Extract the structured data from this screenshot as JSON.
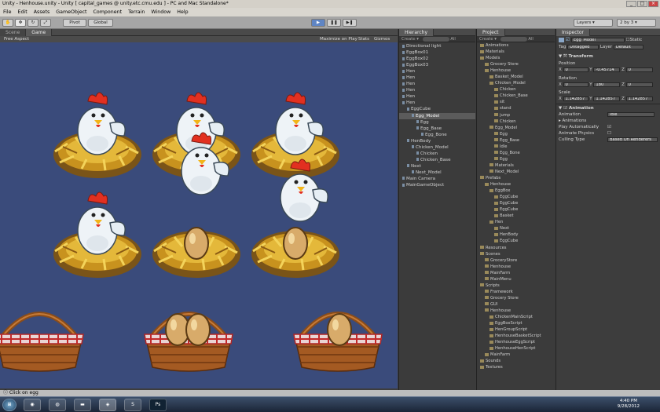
{
  "window": {
    "title": "Unity - Henhouse.unity - Unity [ capital_games @ unity.etc.cmu.edu ] - PC and Mac Standalone*"
  },
  "menu": [
    "File",
    "Edit",
    "Assets",
    "GameObject",
    "Component",
    "Terrain",
    "Window",
    "Help"
  ],
  "toolbar": {
    "pivot": "Pivot",
    "global": "Global",
    "layers": "Layers",
    "layout": "2 by 3"
  },
  "scene": {
    "tab_scene": "Scene",
    "tab_game": "Game",
    "aspect": "Free Aspect",
    "maximize": "Maximize on Play",
    "stats": "Stats",
    "gizmos": "Gizmos"
  },
  "hierarchy": {
    "title": "Hierarchy",
    "create": "Create",
    "search_all": "All",
    "items": [
      {
        "label": "Directional light",
        "indent": 0
      },
      {
        "label": "EggBox01",
        "indent": 0
      },
      {
        "label": "EggBox02",
        "indent": 0
      },
      {
        "label": "EggBox03",
        "indent": 0
      },
      {
        "label": "Hen",
        "indent": 0
      },
      {
        "label": "Hen",
        "indent": 0
      },
      {
        "label": "Hen",
        "indent": 0
      },
      {
        "label": "Hen",
        "indent": 0
      },
      {
        "label": "Hen",
        "indent": 0
      },
      {
        "label": "Hen",
        "indent": 0
      },
      {
        "label": "EggCube",
        "indent": 1
      },
      {
        "label": "Egg_Model",
        "indent": 2,
        "selected": true
      },
      {
        "label": "Egg",
        "indent": 3
      },
      {
        "label": "Egg_Base",
        "indent": 3
      },
      {
        "label": "Egg_Bone",
        "indent": 4
      },
      {
        "label": "HenBody",
        "indent": 1
      },
      {
        "label": "Chicken_Model",
        "indent": 2
      },
      {
        "label": "Chicken",
        "indent": 3
      },
      {
        "label": "Chicken_Base",
        "indent": 3
      },
      {
        "label": "Next",
        "indent": 1
      },
      {
        "label": "Next_Model",
        "indent": 2
      },
      {
        "label": "Main Camera",
        "indent": 0
      },
      {
        "label": "MainGameObject",
        "indent": 0
      }
    ]
  },
  "project": {
    "title": "Project",
    "create": "Create",
    "search_all": "All",
    "items": [
      {
        "label": "Animations",
        "indent": 0
      },
      {
        "label": "Materials",
        "indent": 0
      },
      {
        "label": "Models",
        "indent": 0
      },
      {
        "label": "Grocery Store",
        "indent": 1
      },
      {
        "label": "Henhouse",
        "indent": 1
      },
      {
        "label": "Basket_Model",
        "indent": 2
      },
      {
        "label": "Chicken_Model",
        "indent": 2
      },
      {
        "label": "Chicken",
        "indent": 3
      },
      {
        "label": "Chicken_Base",
        "indent": 3
      },
      {
        "label": "sit",
        "indent": 3
      },
      {
        "label": "stand",
        "indent": 3
      },
      {
        "label": "jump",
        "indent": 3
      },
      {
        "label": "Chicken",
        "indent": 3
      },
      {
        "label": "Egg_Model",
        "indent": 2
      },
      {
        "label": "Egg",
        "indent": 3
      },
      {
        "label": "Egg_Base",
        "indent": 3
      },
      {
        "label": "Idle",
        "indent": 3
      },
      {
        "label": "Egg_Bone",
        "indent": 3
      },
      {
        "label": "Egg",
        "indent": 3
      },
      {
        "label": "Materials",
        "indent": 2
      },
      {
        "label": "Next_Model",
        "indent": 2
      },
      {
        "label": "Prefabs",
        "indent": 0
      },
      {
        "label": "Henhouse",
        "indent": 1
      },
      {
        "label": "EggBox",
        "indent": 2
      },
      {
        "label": "EggCube",
        "indent": 3
      },
      {
        "label": "EggCube",
        "indent": 3
      },
      {
        "label": "EggCube",
        "indent": 3
      },
      {
        "label": "Basket",
        "indent": 3
      },
      {
        "label": "Hen",
        "indent": 2
      },
      {
        "label": "Next",
        "indent": 3
      },
      {
        "label": "HenBody",
        "indent": 3
      },
      {
        "label": "EggCube",
        "indent": 3
      },
      {
        "label": "Resources",
        "indent": 0
      },
      {
        "label": "Scenes",
        "indent": 0
      },
      {
        "label": "GroceryStore",
        "indent": 1
      },
      {
        "label": "Henhouse",
        "indent": 1
      },
      {
        "label": "MainFarm",
        "indent": 1
      },
      {
        "label": "MainMenu",
        "indent": 1
      },
      {
        "label": "Scripts",
        "indent": 0
      },
      {
        "label": "Framework",
        "indent": 1
      },
      {
        "label": "Grocery Store",
        "indent": 1
      },
      {
        "label": "GUI",
        "indent": 1
      },
      {
        "label": "Henhouse",
        "indent": 1
      },
      {
        "label": "ChickenMainScript",
        "indent": 2
      },
      {
        "label": "EggBoxScript",
        "indent": 2
      },
      {
        "label": "HenGroupScript",
        "indent": 2
      },
      {
        "label": "HenhouseBasketScript",
        "indent": 2
      },
      {
        "label": "HenhouseEggScript",
        "indent": 2
      },
      {
        "label": "HenhouseHenScript",
        "indent": 2
      },
      {
        "label": "MainFarm",
        "indent": 1
      },
      {
        "label": "Sounds",
        "indent": 0
      },
      {
        "label": "Textures",
        "indent": 0
      }
    ]
  },
  "inspector": {
    "title": "Inspector",
    "object_name": "Egg_Model",
    "static": "Static",
    "tag_label": "Tag",
    "tag_value": "Untagged",
    "layer_label": "Layer",
    "layer_value": "Default",
    "transform": {
      "title": "Transform",
      "position_label": "Position",
      "rotation_label": "Rotation",
      "scale_label": "Scale",
      "position": {
        "x": "0",
        "y": "-0.45714",
        "z": "0"
      },
      "rotation": {
        "x": "0",
        "y": "180",
        "z": "0"
      },
      "scale": {
        "x": "1.142857",
        "y": "1.142857",
        "z": "1.142857"
      }
    },
    "animation": {
      "title": "Animation",
      "animation_label": "Animation",
      "animation_value": "Idle",
      "animations_label": "Animations",
      "play_auto_label": "Play Automatically",
      "animate_physics_label": "Animate Physics",
      "culling_label": "Culling Type",
      "culling_value": "Based On Renderers"
    }
  },
  "status": {
    "message": "Click on egg"
  },
  "taskbar": {
    "time": "4:40 PM",
    "date": "9/28/2012"
  },
  "scene_content": {
    "nests": [
      {
        "slot": "r1c1",
        "content": "hen"
      },
      {
        "slot": "r1c2",
        "content": "hen"
      },
      {
        "slot": "r1c3",
        "content": "hen"
      },
      {
        "slot": "r2c1",
        "content": "hen"
      },
      {
        "slot": "r2c2",
        "content": "egg"
      },
      {
        "slot": "r2c3",
        "content": "egg"
      }
    ],
    "jumping_hens": 2,
    "baskets": [
      {
        "eggs": 0
      },
      {
        "eggs": 2
      },
      {
        "eggs": 1
      }
    ]
  },
  "colors": {
    "game_bg": "#3a4b7b",
    "panel_bg": "#3b3b3b",
    "selection": "#5b5b5b"
  }
}
